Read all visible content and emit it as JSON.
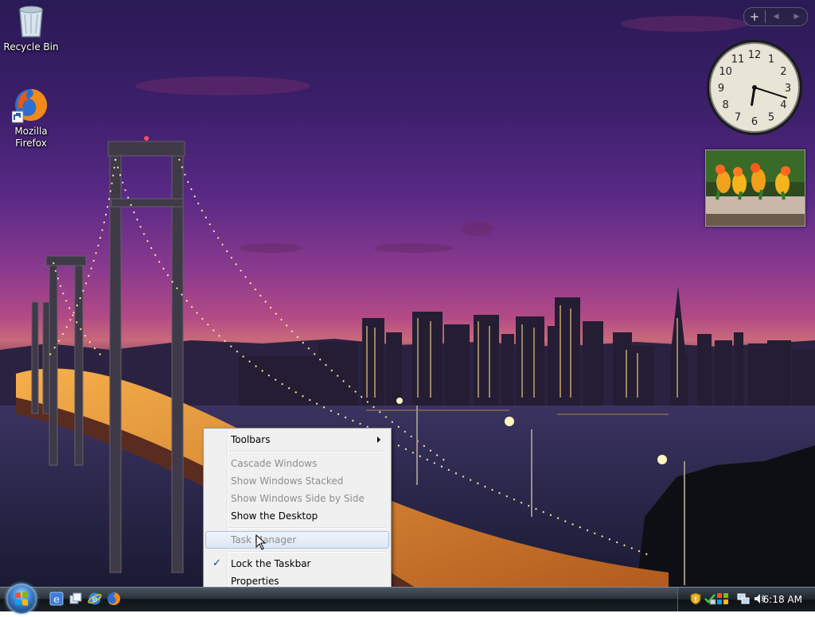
{
  "desktop": {
    "icons": [
      {
        "label": "Recycle Bin",
        "icon": "recycle-bin-icon"
      },
      {
        "label": "Mozilla Firefox",
        "icon": "firefox-icon"
      }
    ]
  },
  "gadgets": {
    "toolbar": {
      "add_symbol": "+",
      "prev_symbol": "◀",
      "next_symbol": "▶"
    },
    "clock": {
      "numerals": [
        "12",
        "1",
        "2",
        "3",
        "4",
        "5",
        "6",
        "7",
        "8",
        "9",
        "10",
        "11"
      ],
      "time": "6:18"
    },
    "slideshow": {
      "subject": "parrots-photo"
    }
  },
  "context_menu": {
    "items": [
      {
        "label": "Toolbars",
        "enabled": true,
        "submenu": true
      },
      {
        "label": "Cascade Windows",
        "enabled": false
      },
      {
        "label": "Show Windows Stacked",
        "enabled": false
      },
      {
        "label": "Show Windows Side by Side",
        "enabled": false
      },
      {
        "label": "Show the Desktop",
        "enabled": true
      },
      {
        "label": "Task Manager",
        "enabled": false,
        "highlighted": true
      },
      {
        "label": "Lock the Taskbar",
        "enabled": true,
        "checked": true
      },
      {
        "label": "Properties",
        "enabled": true
      }
    ],
    "check_symbol": "✓"
  },
  "taskbar": {
    "quick_launch": [
      "internet-explorer-icon",
      "switch-windows-icon",
      "show-desktop-icon",
      "firefox-icon"
    ],
    "tray_icons": [
      "windows-defender-icon",
      "security-center-icon",
      "network-icon",
      "volume-icon"
    ],
    "clock": "6:18 AM"
  },
  "colors": {
    "menu_bg": "#f0f0f0",
    "menu_disabled_text": "#8d8d8d",
    "menu_highlight": "#dce7f5",
    "taskbar": "#1a2026"
  }
}
